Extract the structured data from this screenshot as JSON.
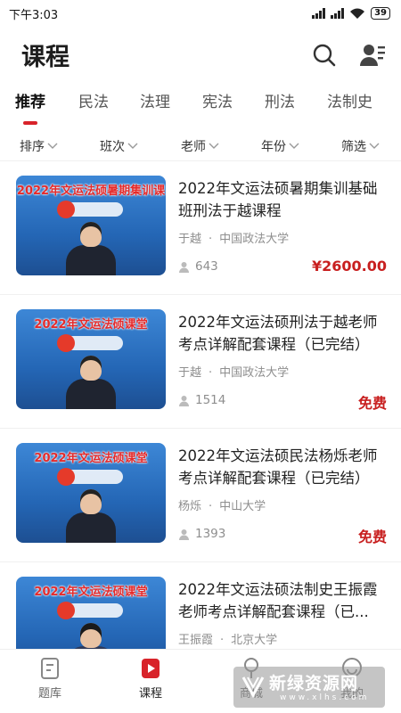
{
  "status_bar": {
    "time": "下午3:03",
    "battery": "39"
  },
  "header": {
    "title": "课程"
  },
  "tabs": [
    {
      "label": "推荐",
      "active": true
    },
    {
      "label": "民法"
    },
    {
      "label": "法理"
    },
    {
      "label": "宪法"
    },
    {
      "label": "刑法"
    },
    {
      "label": "法制史"
    }
  ],
  "filters": [
    "排序",
    "班次",
    "老师",
    "年份",
    "筛选"
  ],
  "courses": [
    {
      "thumb_banner": "2022年文运法硕暑期集训课",
      "title": "2022年文运法硕暑期集训基础班刑法于越课程",
      "teacher": "于越",
      "school": "中国政法大学",
      "count": "643",
      "price": "¥2600.00"
    },
    {
      "thumb_banner": "2022年文运法硕课堂",
      "title": "2022年文运法硕刑法于越老师考点详解配套课程（已完结）",
      "teacher": "于越",
      "school": "中国政法大学",
      "count": "1514",
      "price": "免费"
    },
    {
      "thumb_banner": "2022年文运法硕课堂",
      "title": "2022年文运法硕民法杨烁老师考点详解配套课程（已完结）",
      "teacher": "杨烁",
      "school": "中山大学",
      "count": "1393",
      "price": "免费"
    },
    {
      "thumb_banner": "2022年文运法硕课堂",
      "title": "2022年文运法硕法制史王振霞老师考点详解配套课程（已...",
      "teacher": "王振霞",
      "school": "北京大学",
      "count": "",
      "price": ""
    }
  ],
  "bottom_nav": [
    {
      "label": "题库",
      "icon": "question-bank-icon"
    },
    {
      "label": "课程",
      "icon": "course-play-icon",
      "active": true
    },
    {
      "label": "商城",
      "icon": "shop-icon"
    },
    {
      "label": "我的",
      "icon": "profile-icon"
    }
  ],
  "watermark": {
    "text": "新绿资源网",
    "sub": "www.xlhs.com"
  },
  "colors": {
    "accent": "#d8232a",
    "price": "#c81f1f",
    "meta": "#8e8e8e"
  }
}
